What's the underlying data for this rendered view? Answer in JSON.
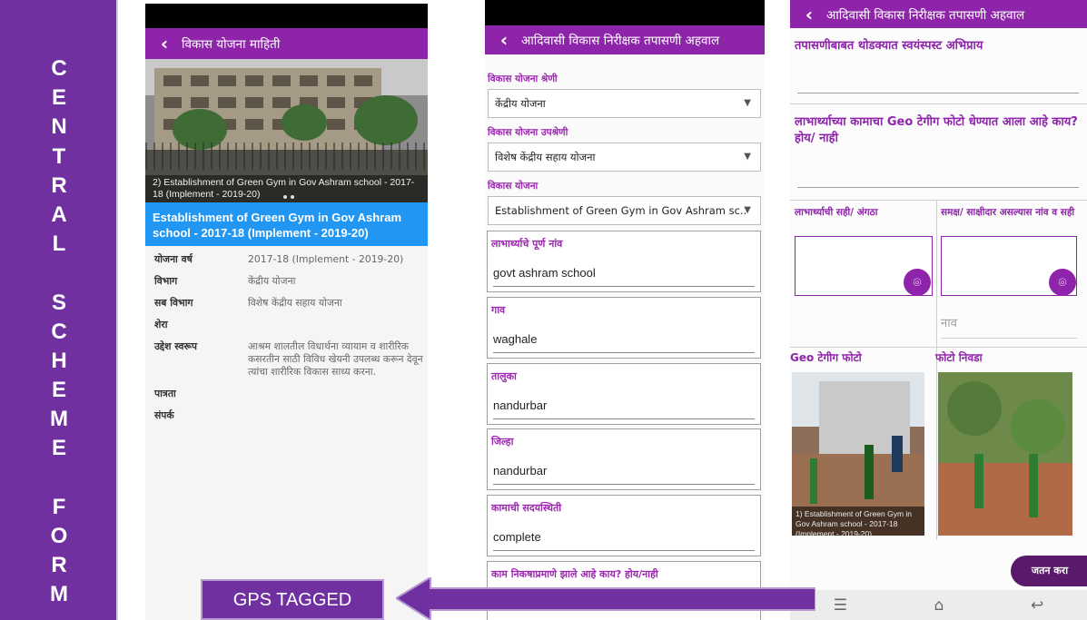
{
  "side_banner": {
    "letters": [
      "C",
      "E",
      "N",
      "T",
      "R",
      "A",
      "L",
      "",
      "S",
      "C",
      "H",
      "E",
      "M",
      "E",
      "",
      "F",
      "O",
      "R",
      "M"
    ]
  },
  "phone1": {
    "title": "विकास योजना माहिती",
    "photo_caption": "2) Establishment of Green Gym in Gov Ashram school - 2017-18 (Implement - 2019-20)",
    "scheme_title": "Establishment of Green Gym in Gov Ashram school - 2017-18 (Implement - 2019-20)",
    "rows": [
      {
        "key": "योजना वर्ष",
        "value": "2017-18 (Implement - 2019-20)"
      },
      {
        "key": "विभाग",
        "value": "केंद्रीय योजना"
      },
      {
        "key": "सब विभाग",
        "value": "विशेष केंद्रीय सहाय योजना"
      },
      {
        "key": "शेरा",
        "value": ""
      },
      {
        "key": "उद्देश स्वरूप",
        "value": "आश्रम शालतील विधार्थना व्यायाम व शारीरिक कसरतीन साठी विविध खेयनी उपलब्ध करून देवून त्यांचा शारीरिक विकास साध्य करना."
      },
      {
        "key": "पात्रता",
        "value": ""
      },
      {
        "key": "संपर्क",
        "value": ""
      }
    ]
  },
  "phone2": {
    "title": "आदिवासी विकास निरीक्षक तपासणी अहवाल",
    "category_label": "विकास योजना श्रेणी",
    "category_value": "केंद्रीय योजना",
    "subcategory_label": "विकास योजना उपश्रेणी",
    "subcategory_value": "विशेष केंद्रीय सहाय योजना",
    "scheme_label": "विकास योजना",
    "scheme_value": "Establishment of Green Gym in Gov Ashram sc..",
    "fields": [
      {
        "label": "लाभार्थ्याचे पूर्ण नांव",
        "value": "govt ashram school"
      },
      {
        "label": "गाव",
        "value": "waghale"
      },
      {
        "label": "तालुका",
        "value": "nandurbar"
      },
      {
        "label": "जिल्हा",
        "value": "nandurbar"
      },
      {
        "label": "कामाची सदयस्थिती",
        "value": "complete"
      }
    ],
    "last_question": "काम निकषाप्रमाणे झाले आहे काय? होय/नाही"
  },
  "phone3": {
    "title": "आदिवासी विकास निरीक्षक तपासणी अहवाल",
    "q1": "तपासणीबाबत थोडक्यात स्वयंस्पस्ट अभिप्राय",
    "q2": "लाभार्थ्याच्या कामाचा Geo टेगीग फोटो धेण्यात आला आहे काय? होय/ नाही",
    "sig_label": "लाभार्थ्याची सही/ अंगठा",
    "witness_label": "समक्ष/ साक्षीदार असल्यास नांव व सही",
    "village_placeholder": "नाव",
    "geo_photo_label": "Geo टेगीग फोटो",
    "select_photo_label": "फोटो निवडा",
    "photo_caption": "1) Establishment of Green Gym in Gov Ashram school - 2017-18 (Implement - 2019-20)",
    "save_label": "जतन करा"
  },
  "gps_tag": "GPS TAGGED",
  "colors": {
    "banner_purple": "#7030a0",
    "appbar_purple": "#8e24aa",
    "label_purple": "#9c27b0",
    "title_blue": "#2196f3"
  }
}
